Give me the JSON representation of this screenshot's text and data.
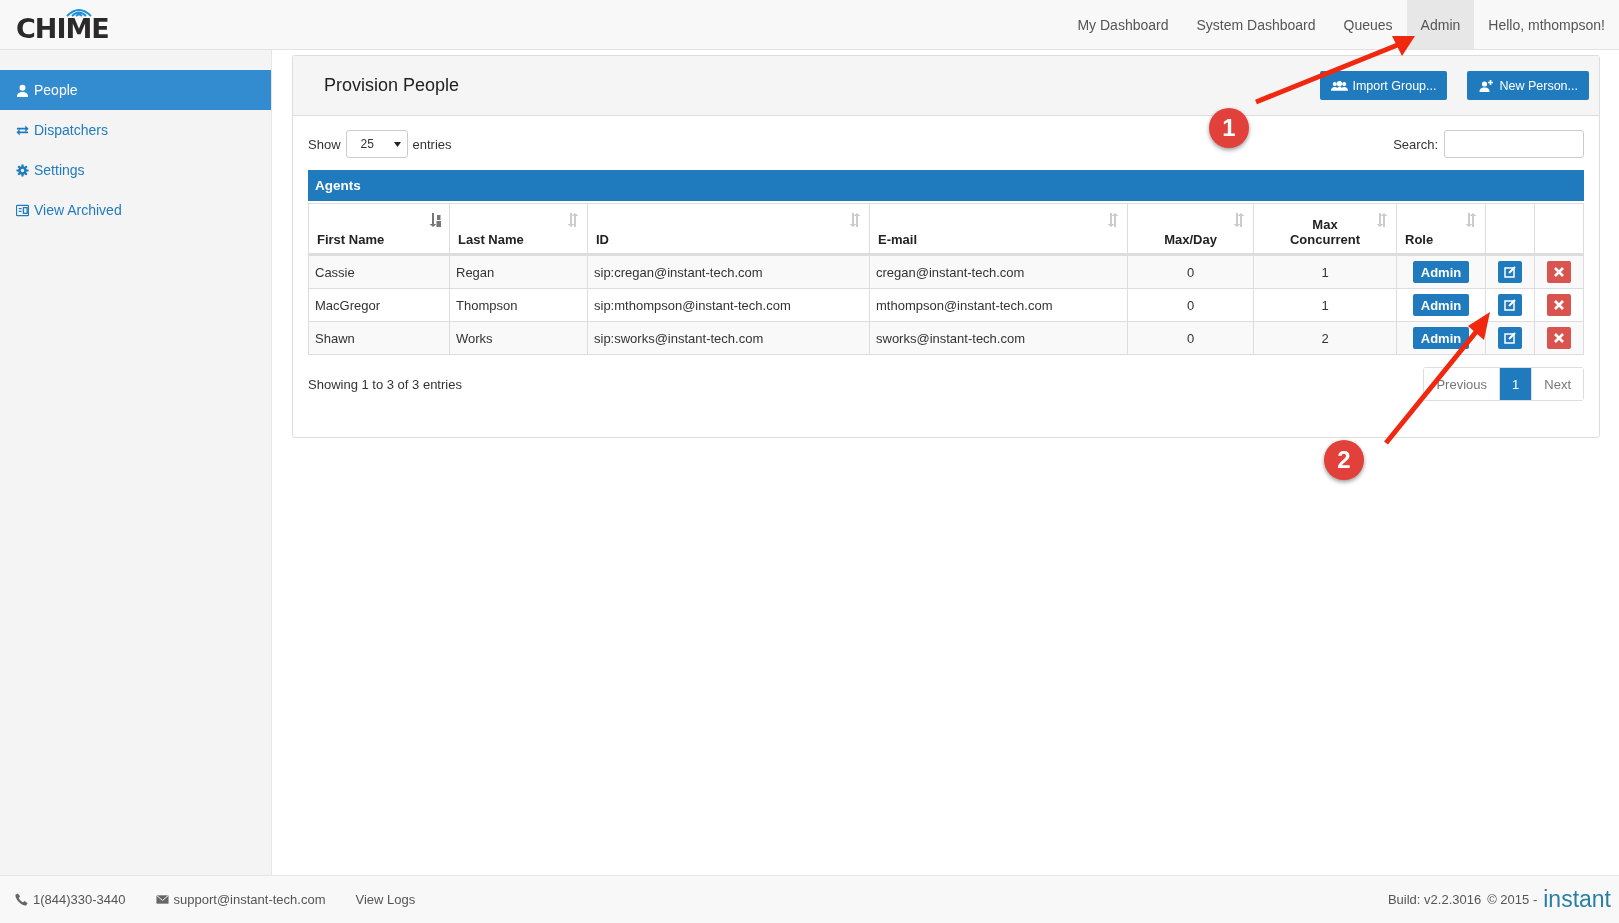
{
  "header": {
    "logo": "CHIME",
    "nav": [
      {
        "label": "My Dashboard",
        "selected": false
      },
      {
        "label": "System Dashboard",
        "selected": false
      },
      {
        "label": "Queues",
        "selected": false
      },
      {
        "label": "Admin",
        "selected": true
      },
      {
        "label": "Hello, mthompson!",
        "selected": false
      }
    ]
  },
  "sidebar": {
    "items": [
      {
        "label": "People",
        "selected": true
      },
      {
        "label": "Dispatchers",
        "selected": false
      },
      {
        "label": "Settings",
        "selected": false
      },
      {
        "label": "View Archived",
        "selected": false
      }
    ]
  },
  "panel": {
    "title": "Provision People",
    "buttons": [
      {
        "label": "Import Group..."
      },
      {
        "label": "New Person..."
      }
    ],
    "length": {
      "before": "Show",
      "value": "25",
      "after": "entries"
    },
    "search": {
      "label": "Search:"
    },
    "table": {
      "caption": "Agents",
      "columns": [
        {
          "label": "First Name",
          "sorted": true
        },
        {
          "label": "Last Name",
          "sorted": false
        },
        {
          "label": "ID",
          "sorted": false
        },
        {
          "label": "E-mail",
          "sorted": false
        },
        {
          "label": "Max/Day",
          "sorted": false
        },
        {
          "label": "Max Concurrent",
          "sorted": false
        },
        {
          "label": "Role",
          "sorted": false
        }
      ],
      "rows": [
        {
          "cells": [
            "Cassie",
            "Regan",
            "sip:cregan@instant-tech.com",
            "cregan@instant-tech.com",
            "0",
            "1"
          ],
          "role": "Admin"
        },
        {
          "cells": [
            "MacGregor",
            "Thompson",
            "sip:mthompson@instant-tech.com",
            "mthompson@instant-tech.com",
            "0",
            "1"
          ],
          "role": "Admin"
        },
        {
          "cells": [
            "Shawn",
            "Works",
            "sip:sworks@instant-tech.com",
            "sworks@instant-tech.com",
            "0",
            "2"
          ],
          "role": "Admin"
        }
      ]
    },
    "info": "Showing 1 to 3 of 3 entries",
    "pagination": [
      {
        "label": "Previous",
        "selected": false
      },
      {
        "label": "1",
        "selected": true
      },
      {
        "label": "Next",
        "selected": false
      }
    ]
  },
  "annotations": [
    {
      "label": "1"
    },
    {
      "label": "2"
    }
  ],
  "footer": {
    "phone": "1(844)330-3440",
    "email": "support@instant-tech.com",
    "logs": "View Logs",
    "build": "Build: v2.2.3016",
    "copyright": "© 2015 -",
    "brand": "instant"
  }
}
